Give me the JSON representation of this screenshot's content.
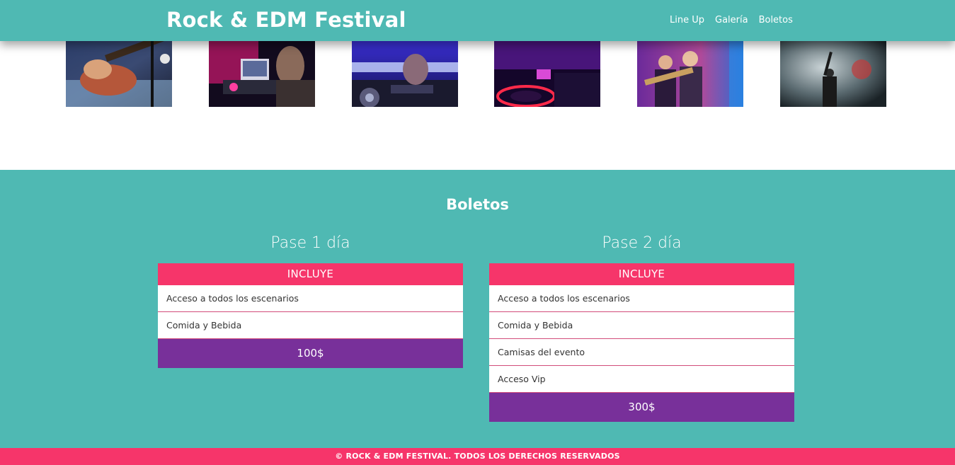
{
  "header": {
    "site_title": "Rock & EDM Festival",
    "nav": [
      {
        "label": "Line Up"
      },
      {
        "label": "Galería"
      },
      {
        "label": "Boletos"
      }
    ]
  },
  "gallery": {
    "images": [
      {
        "subject": "guitarist-closeup"
      },
      {
        "subject": "dj-with-laptop"
      },
      {
        "subject": "dj-mixer-hands"
      },
      {
        "subject": "turntable-neon"
      },
      {
        "subject": "rock-band-stage"
      },
      {
        "subject": "crowd-singer-smoke"
      }
    ]
  },
  "tickets": {
    "title": "Boletos",
    "passes": [
      {
        "name": "Pase 1 día",
        "header": "INCLUYE",
        "items": [
          "Acceso a todos los escenarios",
          "Comida y Bebida"
        ],
        "price": "100$"
      },
      {
        "name": "Pase 2 día",
        "header": "INCLUYE",
        "items": [
          "Acceso a todos los escenarios",
          "Comida y Bebida",
          "Camisas del evento",
          "Acceso Vip"
        ],
        "price": "300$"
      }
    ]
  },
  "footer": {
    "text": "© ROCK & EDM FESTIVAL. TODOS LOS DERECHOS RESERVADOS"
  },
  "colors": {
    "teal": "#4fb9b3",
    "pink": "#f6356a",
    "purple": "#78309a",
    "white": "#ffffff"
  }
}
